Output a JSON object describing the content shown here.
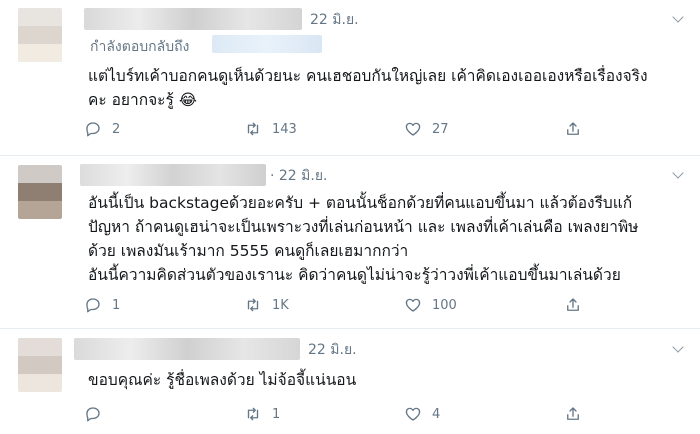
{
  "tweets": [
    {
      "date": "22 มิ.ย.",
      "reply_label": "กำลังตอบกลับถึง",
      "lines": [
        "แต่ไบร์ทเค้าบอกคนดูเห็นด้วยนะ คนเฮชอบกันใหญ่เลย เค้าคิดเองเออเองหรือเรื่องจริง",
        "คะ อยากจะรู้ 😂"
      ],
      "counts": {
        "reply": "2",
        "retweet": "143",
        "like": "27"
      }
    },
    {
      "date": "· 22 มิ.ย.",
      "lines": [
        "อันนี้เป็น backstageด้วยอะครับ + ตอนนั้นช็อกด้วยที่คนแอบขึ้นมา แล้วต้องรีบแก้",
        "ปัญหา ถ้าคนดูเฮน่าจะเป็นเพราะวงที่เล่นก่อนหน้า และ เพลงที่เค้าเล่นคือ เพลงยาพิษ",
        "ด้วย เพลงมันเร้ามาก 5555 คนดูก็เลยเฮมากกว่า",
        "อันนี้ความคิดส่วนตัวของเรานะ คิดว่าคนดูไม่น่าจะรู้ว่าวงพี่เค้าแอบขึ้นมาเล่นด้วย"
      ],
      "counts": {
        "reply": "1",
        "retweet": "1K",
        "like": "100"
      }
    },
    {
      "date": "22 มิ.ย.",
      "lines": [
        "ขอบคุณค่ะ รู้ชื่อเพลงด้วย ไม่จ้อจี้แน่นอน"
      ],
      "counts": {
        "reply": "",
        "retweet": "1",
        "like": "4"
      }
    }
  ],
  "icons": [
    "reply-icon",
    "retweet-icon",
    "like-icon",
    "share-icon",
    "caret-down-icon"
  ],
  "colors": {
    "text": "#14171a",
    "muted": "#657786",
    "divider": "#e6ecf0"
  }
}
